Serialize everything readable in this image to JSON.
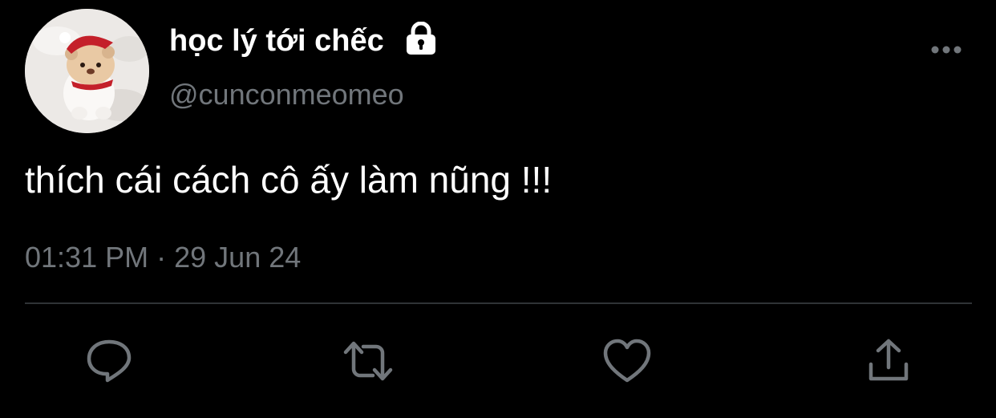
{
  "user": {
    "display_name": "học lý tới chếc",
    "handle": "@cunconmeomeo",
    "avatar_icon": "snow-bear-avatar",
    "protected_icon": "lock-icon"
  },
  "tweet": {
    "text": "thích cái cách cô ấy làm nũng !!!",
    "time": "01:31 PM",
    "separator": "·",
    "date": "29 Jun 24"
  },
  "actions": [
    {
      "name": "reply",
      "icon": "reply-icon"
    },
    {
      "name": "retweet",
      "icon": "retweet-icon"
    },
    {
      "name": "like",
      "icon": "heart-icon"
    },
    {
      "name": "share",
      "icon": "share-icon"
    }
  ],
  "colors": {
    "background": "#000000",
    "primary_text": "#ffffff",
    "secondary_text": "#71767b",
    "divider": "#2f3336",
    "icon": "#71767b"
  }
}
